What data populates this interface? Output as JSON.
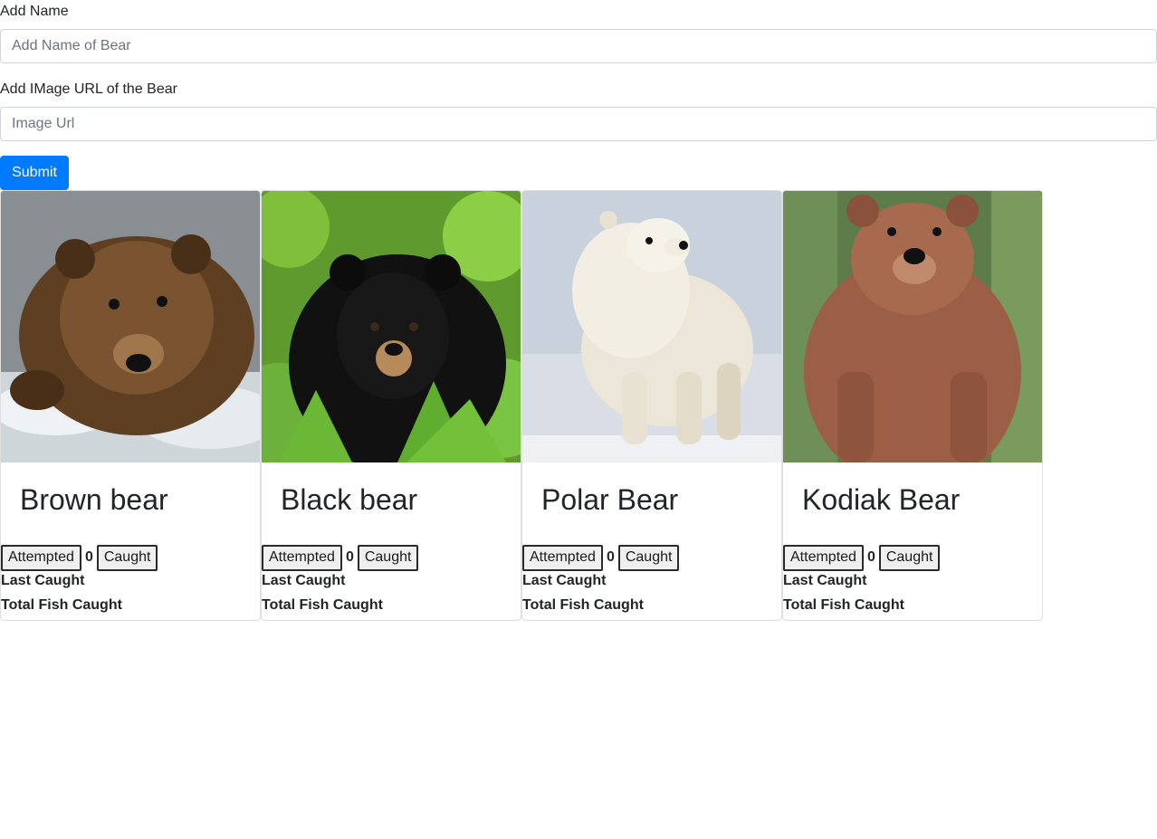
{
  "form": {
    "name_label": "Add Name",
    "name_placeholder": "Add Name of Bear",
    "name_value": "",
    "url_label": "Add IMage URL of the Bear",
    "url_placeholder": "Image Url",
    "url_value": "",
    "submit_label": "Submit",
    "submit_color": "#007bff"
  },
  "bears": [
    {
      "name": "Brown bear",
      "attempted_label": "Attempted",
      "count": "0",
      "caught_label": "Caught",
      "last_caught_label": "Last Caught",
      "total_label": "Total Fish Caught",
      "fur_color": "#6b4a2b"
    },
    {
      "name": "Black bear",
      "attempted_label": "Attempted",
      "count": "0",
      "caught_label": "Caught",
      "last_caught_label": "Last Caught",
      "total_label": "Total Fish Caught",
      "fur_color": "#121212"
    },
    {
      "name": "Polar Bear",
      "attempted_label": "Attempted",
      "count": "0",
      "caught_label": "Caught",
      "last_caught_label": "Last Caught",
      "total_label": "Total Fish Caught",
      "fur_color": "#ece6d8"
    },
    {
      "name": "Kodiak Bear",
      "attempted_label": "Attempted",
      "count": "0",
      "caught_label": "Caught",
      "last_caught_label": "Last Caught",
      "total_label": "Total Fish Caught",
      "fur_color": "#a86a4e"
    }
  ]
}
